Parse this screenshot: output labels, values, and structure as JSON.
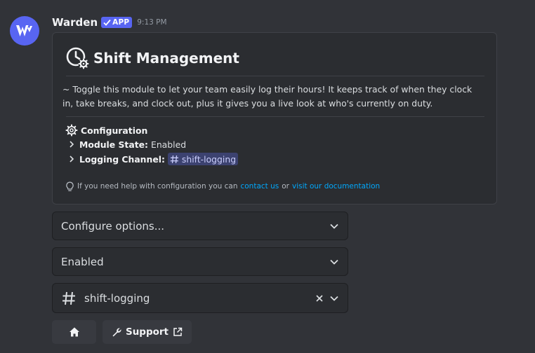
{
  "message": {
    "username": "Warden",
    "badge": "APP",
    "timestamp": "9:13 PM"
  },
  "embed": {
    "title": "Shift Management",
    "description": "~ Toggle this module to let your team easily log their hours! It keeps track of when they clock in, take breaks, and clock out, plus it gives you a live look at who's currently on duty.",
    "config_heading": "Configuration",
    "module_state_label": "Module State:",
    "module_state_value": "Enabled",
    "logging_channel_label": "Logging Channel:",
    "logging_channel_value": "shift-logging",
    "help_prefix": "If you need help with configuration you can",
    "help_link1": "contact us",
    "help_or": "or",
    "help_link2": "visit our documentation"
  },
  "selects": {
    "configure_placeholder": "Configure options...",
    "state_value": "Enabled",
    "channel_value": "shift-logging"
  },
  "buttons": {
    "support_label": "Support"
  },
  "colors": {
    "background": "#313338",
    "embed_background": "#2b2d31",
    "brand": "#5865f2",
    "link": "#00a8fc",
    "mention_bg": "#3c4270"
  },
  "icons": {
    "avatar": "warden-logo-icon",
    "badge": "checkmark-icon",
    "title": "clock-gear-icon",
    "config": "gear-icon",
    "row": "chevron-right-icon",
    "help": "lightbulb-icon",
    "select": "chevron-down-icon",
    "channel": "hash-icon",
    "clear": "close-icon",
    "home": "home-icon",
    "support": "wrench-icon",
    "external": "external-link-icon"
  }
}
